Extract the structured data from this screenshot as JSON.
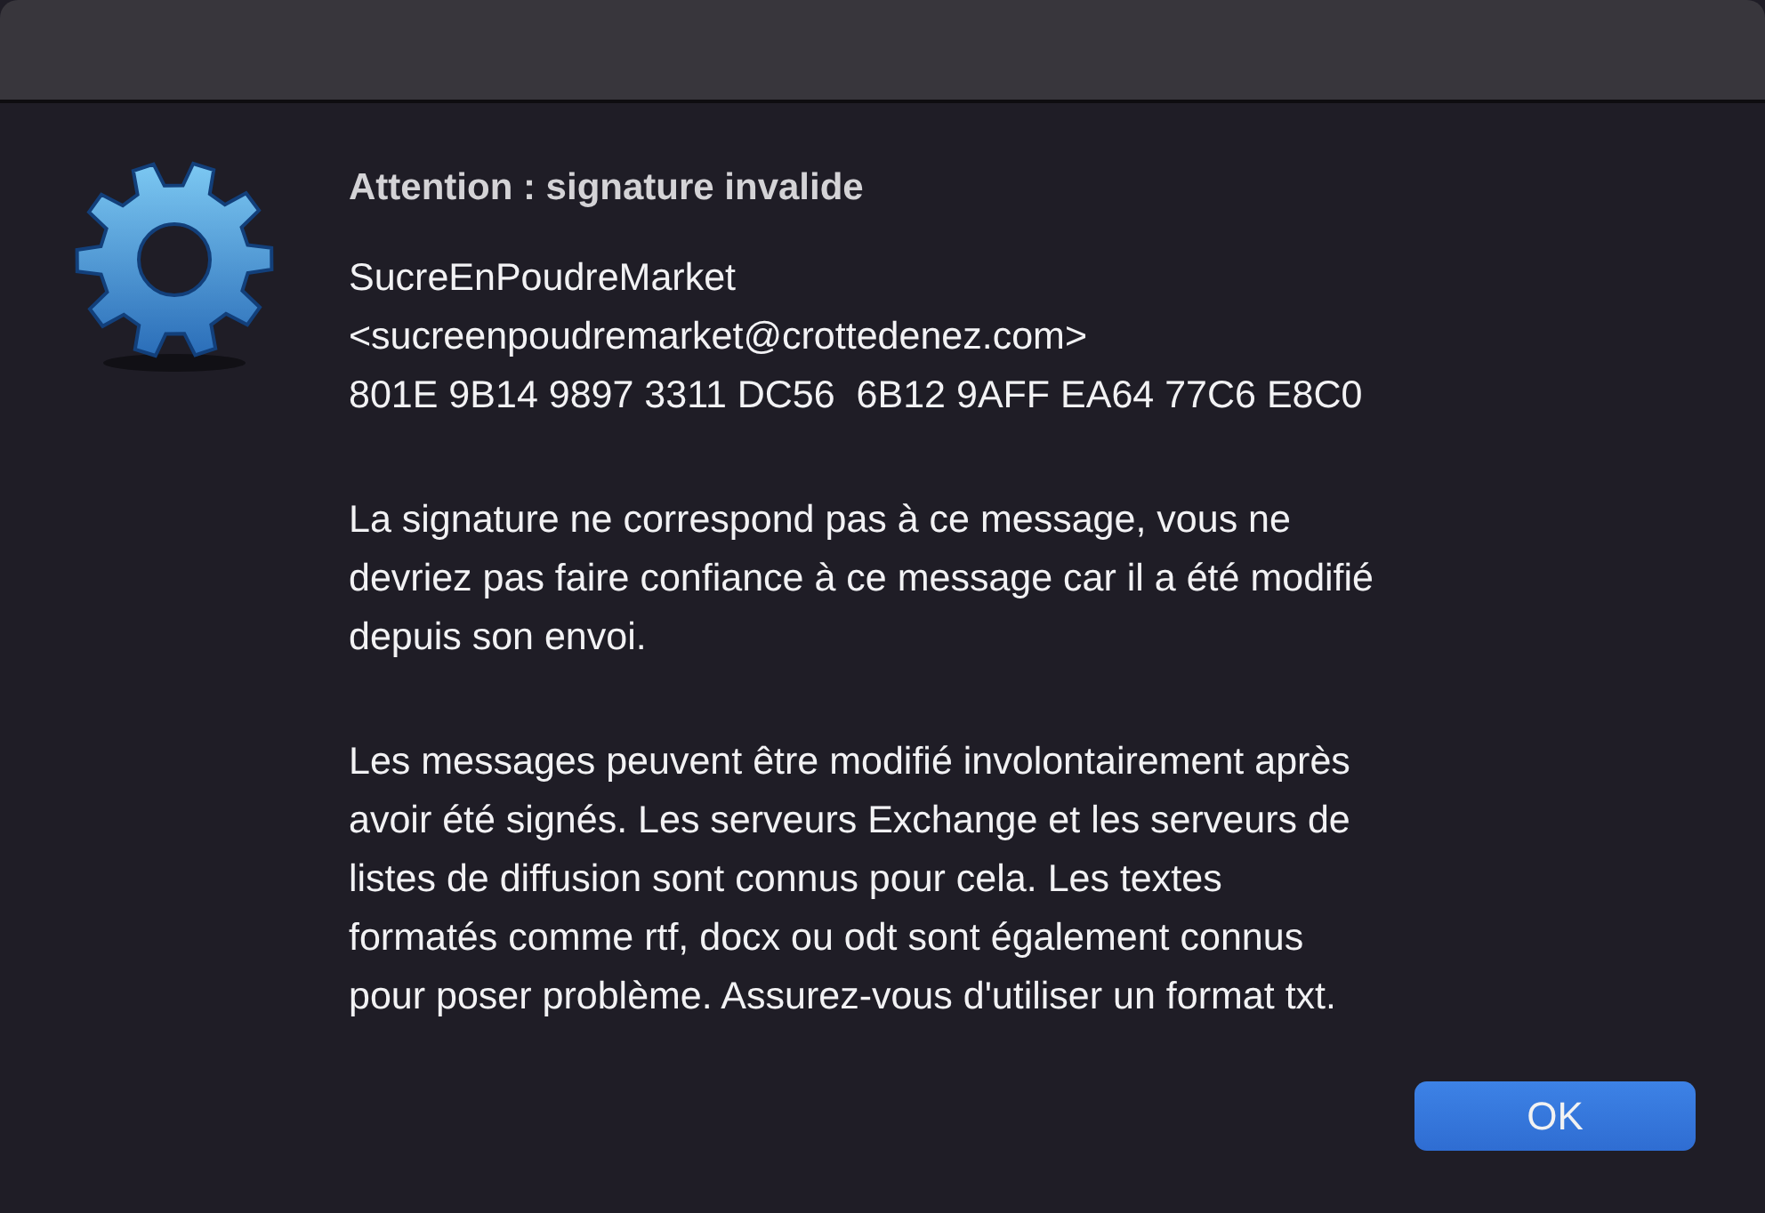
{
  "dialog": {
    "title": "Attention : signature invalide",
    "signer": [
      "SucreEnPoudreMarket",
      "<sucreenpoudremarket@crottedenez.com>",
      "801E 9B14 9897 3311 DC56  6B12 9AFF EA64 77C6 E8C0"
    ],
    "paragraphs": [
      [
        "La signature ne correspond pas à ce message, vous ne",
        "devriez pas faire confiance à ce message car il a été modifié",
        "depuis son envoi."
      ],
      [
        "Les messages peuvent être modifié involontairement après",
        "avoir été signés. Les serveurs Exchange et les serveurs de",
        "listes de diffusion sont connus pour cela. Les textes",
        "formatés comme rtf, docx ou odt sont également connus",
        "pour poser problème. Assurez-vous d'utiliser un format txt."
      ]
    ],
    "buttons": [
      {
        "label": "OK",
        "default": true
      }
    ]
  }
}
